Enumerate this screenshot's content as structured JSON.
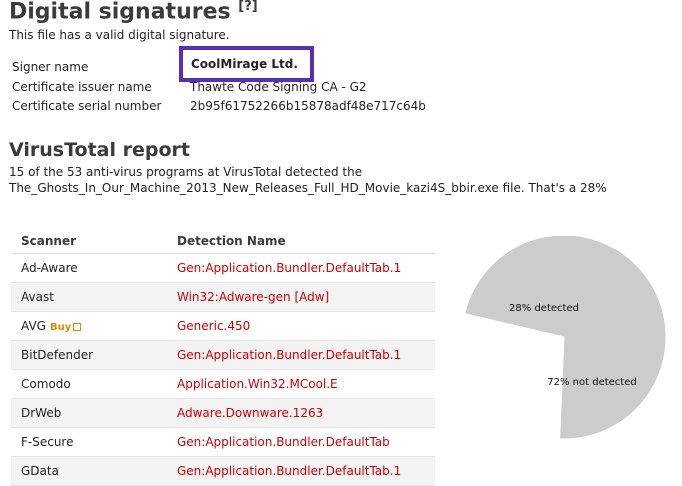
{
  "signatures": {
    "title": "Digital signatures",
    "help": "[?]",
    "status": "This file has a valid digital signature.",
    "rows": [
      {
        "label": "Signer name",
        "value": "CoolMirage Ltd."
      },
      {
        "label": "Certificate issuer name",
        "value": "Thawte Code Signing CA - G2"
      },
      {
        "label": "Certificate serial number",
        "value": "2b95f61752266b15878adf48e717c64b"
      }
    ],
    "highlight_color": "#5b2db8"
  },
  "report": {
    "title": "VirusTotal report",
    "line1": "15 of the 53 anti-virus programs at VirusTotal detected the",
    "line2": "The_Ghosts_In_Our_Machine_2013_New_Releases_Full_HD_Movie_kazi4S_bbir.exe file. That's a 28%",
    "columns": [
      "Scanner",
      "Detection Name"
    ],
    "rows": [
      {
        "scanner": "Ad-Aware",
        "detection": "Gen:Application.Bundler.DefaultTab.1"
      },
      {
        "scanner": "Avast",
        "detection": "Win32:Adware-gen [Adw]"
      },
      {
        "scanner": "AVG",
        "buy": "Buy",
        "detection": "Generic.450"
      },
      {
        "scanner": "BitDefender",
        "detection": "Gen:Application.Bundler.DefaultTab.1"
      },
      {
        "scanner": "Comodo",
        "detection": "Application.Win32.MCool.E"
      },
      {
        "scanner": "DrWeb",
        "detection": "Adware.Downware.1263"
      },
      {
        "scanner": "F-Secure",
        "detection": "Gen:Application.Bundler.DefaultTab"
      },
      {
        "scanner": "GData",
        "detection": "Gen:Application.Bundler.DefaultTab.1"
      }
    ],
    "detection_color": "#cc0000"
  },
  "chart_data": {
    "type": "pie",
    "slices": [
      {
        "label": "28% detected",
        "value": 28,
        "color": "#ff7f7f"
      },
      {
        "label": "72% not detected",
        "value": 72,
        "color": "#cccccc"
      }
    ]
  }
}
